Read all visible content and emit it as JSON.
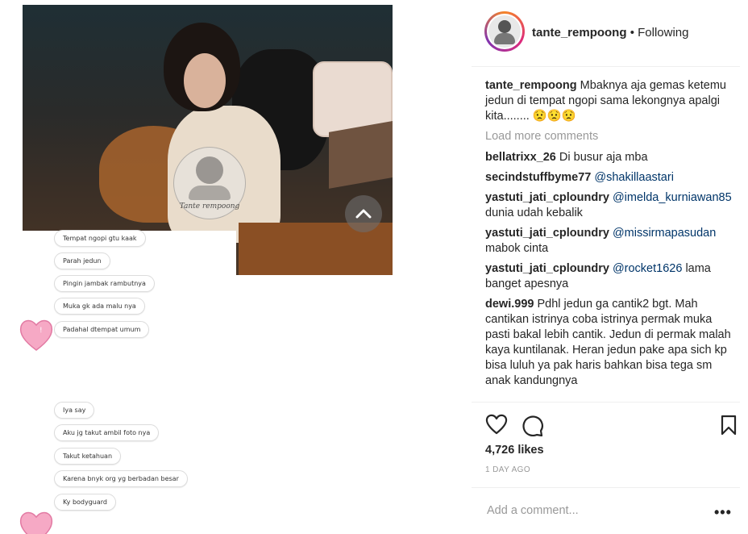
{
  "media": {
    "watermark_text": "Tante rempoong",
    "chat": {
      "group1": [
        "Tempat ngopi gtu kaak",
        "Parah jedun",
        "Pingin jambak rambutnya",
        "Muka gk ada malu nya",
        "Padahal dtempat umum"
      ],
      "group2": [
        "Iya say",
        "Aku jg takut ambil foto nya",
        "Takut ketahuan",
        "Karena bnyk org yg berbadan besar",
        "Ky bodyguard"
      ]
    }
  },
  "header": {
    "username": "tante_rempoong",
    "separator": "•",
    "follow_status": "Following"
  },
  "caption": {
    "user": "tante_rempoong",
    "text": "Mbaknya aja gemas ketemu jedun di tempat ngopi sama lekongnya apalgi kita........ 😟😟😟"
  },
  "load_more": "Load more comments",
  "comments": [
    {
      "user": "bellatrixx_26",
      "mention": "",
      "text": "Di busur aja mba"
    },
    {
      "user": "secindstuffbyme77",
      "mention": "@shakillaastari",
      "text": ""
    },
    {
      "user": "yastuti_jati_cploundry",
      "mention": "@imelda_kurniawan85",
      "text": "dunia udah kebalik"
    },
    {
      "user": "yastuti_jati_cploundry",
      "mention": "@missirmapasudan",
      "text": "mabok cinta"
    },
    {
      "user": "yastuti_jati_cploundry",
      "mention": "@rocket1626",
      "text": "lama banget apesnya"
    },
    {
      "user": "dewi.999",
      "mention": "",
      "text": "Pdhl jedun ga cantik2 bgt. Mah cantikan istrinya coba istrinya permak muka pasti bakal lebih cantik. Jedun di permak malah kaya kuntilanak. Heran jedun pake apa sich kp bisa luluh ya pak haris bahkan bisa tega sm anak kandungnya"
    }
  ],
  "likes": "4,726 likes",
  "time": "1 DAY AGO",
  "add_comment_placeholder": "Add a comment...",
  "more_label": "•••",
  "icons": {
    "like": "heart-outline-icon",
    "comment": "speech-bubble-icon",
    "save": "bookmark-icon",
    "scroll": "chevron-up-icon"
  },
  "colors": {
    "text": "#262626",
    "muted": "#999999",
    "mention": "#003569",
    "border": "#efefef"
  }
}
